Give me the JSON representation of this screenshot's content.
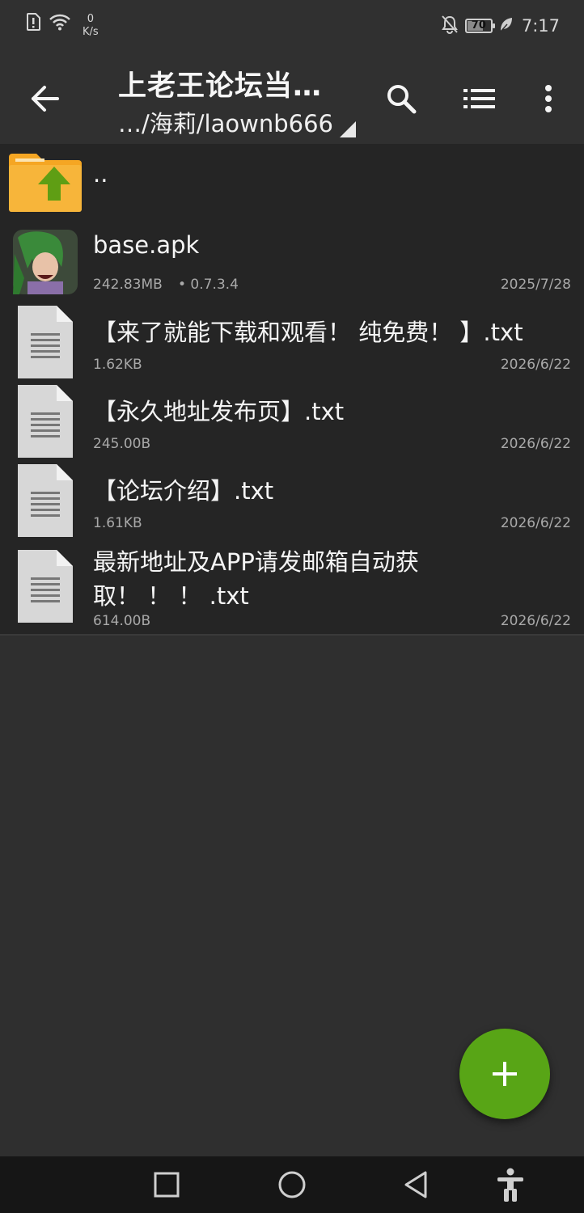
{
  "status_bar": {
    "speed_value": "0",
    "speed_unit": "K/s",
    "battery": "70",
    "battery_level": 0.7,
    "time": "7:17"
  },
  "app_bar": {
    "title": "上老王论坛当…",
    "path": "…/海莉/laownb666",
    "icons": [
      "back-arrow-icon",
      "search-icon",
      "list-view-icon",
      "more-vert-icon"
    ]
  },
  "files": {
    "parent": {
      "name": ".."
    },
    "items": [
      {
        "name": "base.apk",
        "size": "242.83MB",
        "version": "• 0.7.3.4",
        "date": "2025/7/28",
        "icon": "apk-app-icon"
      },
      {
        "name": "【来了就能下载和观看！ 纯免费！ 】.txt",
        "size": "1.62KB",
        "date": "2026/6/22",
        "icon": "text-file-icon"
      },
      {
        "name": "【永久地址发布页】.txt",
        "size": "245.00B",
        "date": "2026/6/22",
        "icon": "text-file-icon"
      },
      {
        "name": "【论坛介绍】.txt",
        "size": "1.61KB",
        "date": "2026/6/22",
        "icon": "text-file-icon"
      },
      {
        "name_line1": "最新地址及APP请发邮箱自动获",
        "name_line2": "取！ ！ ！ .txt",
        "size": "614.00B",
        "date": "2026/6/22",
        "icon": "text-file-icon"
      }
    ]
  },
  "fab": {
    "icon": "plus-icon"
  },
  "colors": {
    "background": "#2f2f2f",
    "list_background": "#252525",
    "fab": "#58a516",
    "folder": "#f5a623",
    "folder_arrow": "#5f9e14"
  }
}
